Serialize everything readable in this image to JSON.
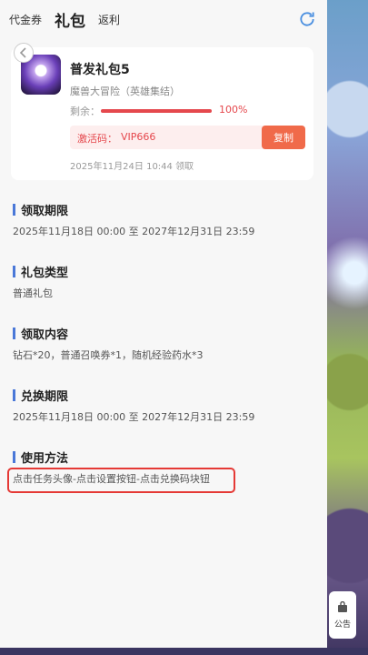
{
  "header": {
    "tabs": [
      "代金券",
      "礼包",
      "返利"
    ]
  },
  "card": {
    "title": "普发礼包5",
    "game": "魔兽大冒险（英雄集结）",
    "remain_label": "剩余：",
    "progress_percent": 100,
    "progress_text": "100%",
    "code_label": "激活码：",
    "code_value": "VIP666",
    "copy_label": "复制",
    "claim_time": "2025年11月24日 10:44 领取"
  },
  "sections": [
    {
      "title": "领取期限",
      "body": "2025年11月18日 00:00 至 2027年12月31日 23:59"
    },
    {
      "title": "礼包类型",
      "body": "普通礼包"
    },
    {
      "title": "领取内容",
      "body": "钻石*20，普通召唤券*1，随机经验药水*3"
    },
    {
      "title": "兑换期限",
      "body": "2025年11月18日 00:00 至 2027年12月31日 23:59"
    },
    {
      "title": "使用方法",
      "body": "点击任务头像-点击设置按钮-点击兑换码块钮"
    }
  ],
  "notice": {
    "label": "公告"
  },
  "colors": {
    "accent": "#4a78d8",
    "danger": "#e5484d",
    "copy_button": "#f06a4a"
  }
}
